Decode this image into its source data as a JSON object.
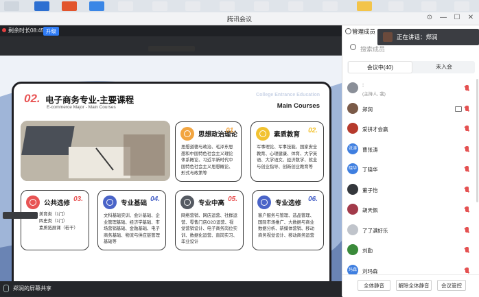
{
  "window": {
    "title": "腾讯会议"
  },
  "meeting": {
    "timer": "剩余时长08:45",
    "upgrade": "升级",
    "bottom_share": "郑润的屏幕共享",
    "zoom_label": "",
    "mini_speaker": "正在讲话：郑润"
  },
  "slide": {
    "number": "02.",
    "title": "电子商务专业-主要课程",
    "subtitle": "E-commerce Major - Main Courses",
    "en_tag": "College Entrance Education",
    "main_courses": "Main Courses",
    "cards": [
      {
        "name": "思想政治理论",
        "no": "01.",
        "color": "#f2a541",
        "desc": "思想道德与政治、毛泽东思想和中国特色社会主义理论体系概论、习近平新时代中国特色社会主义思想概论、形式与政策等"
      },
      {
        "name": "素质教育",
        "no": "02.",
        "color": "#f2c230",
        "desc": "军事理论、军事技能、国家安全教育、心理健康、体育、大学英语、大学语文、经济数学、就业与创业指导、创新创业教育等"
      },
      {
        "name": "公共选修",
        "no": "03.",
        "color": "#e85454",
        "desc": "美育类（1门）\n四史类（1门）\n素质拓展课（若干）"
      },
      {
        "name": "专业基础",
        "no": "04.",
        "color": "#4a64c8",
        "desc": "文科基础实训、会计基础、企业管理基础、经济学基础、市场营销基础、金融基础、电子商务基础、物流与供应链管理基础等"
      },
      {
        "name": "专业中高",
        "no": "05.",
        "color": "#e85454",
        "desc": "网络营销、网店运营、社群运营、零售门店O2O运营、视觉营销设计、电子商务岗位实训、数据化运营、直岗实习、毕业设计"
      },
      {
        "name": "专业选修",
        "no": "06.",
        "color": "#4a64c8",
        "desc": "客户服务与管理、选品管理、国际市场推广、大数据与商业数据分析、新媒体营销、移动商务视觉设计、移动商务运营"
      }
    ]
  },
  "panel": {
    "header": "管理成员",
    "speaking": "正在讲话：郑润",
    "search_placeholder": "搜索成员",
    "tab_in": "会议中(40)",
    "tab_out": "未入会",
    "members": [
      {
        "name": ":",
        "tag": "(主持人, 我)",
        "avatar": "",
        "color": "#8a8f98"
      },
      {
        "name": "郑润",
        "tag": "",
        "avatar": "",
        "color": "#7a5a48"
      },
      {
        "name": "爱拼才会赢",
        "tag": "",
        "avatar": "",
        "color": "#b63a2c"
      },
      {
        "name": "曹张涛",
        "tag": "",
        "avatar": "张涛",
        "color": "#3f7fe0"
      },
      {
        "name": "丁晓华",
        "tag": "",
        "avatar": "晓华",
        "color": "#3f7fe0"
      },
      {
        "name": "董子怡",
        "tag": "",
        "avatar": "",
        "color": "#34373c"
      },
      {
        "name": "胡天佩",
        "tag": "",
        "avatar": "",
        "color": "#a23a4a"
      },
      {
        "name": "了了满好乐",
        "tag": "",
        "avatar": "",
        "color": "#c0c4cb"
      },
      {
        "name": "刘勤",
        "tag": "",
        "avatar": "",
        "color": "#3a8a3a"
      },
      {
        "name": "刘玛森",
        "tag": "",
        "avatar": "玛森",
        "color": "#3f7fe0"
      }
    ],
    "btn_mute_all": "全体静音",
    "btn_unmute_all": "解除全体静音",
    "btn_manage": "会议管控"
  }
}
